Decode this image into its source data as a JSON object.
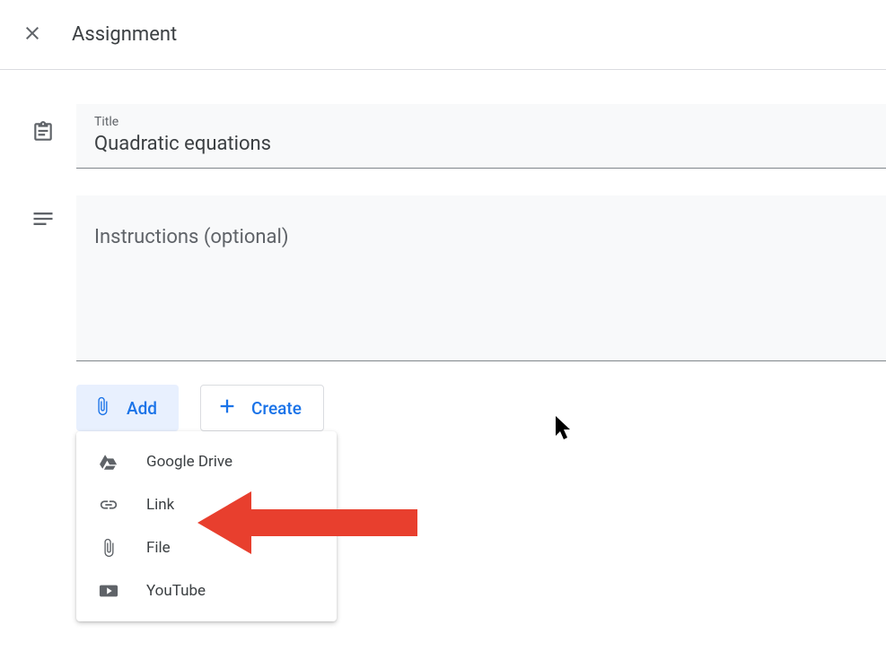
{
  "header": {
    "title": "Assignment"
  },
  "form": {
    "title_label": "Title",
    "title_value": "Quadratic equations",
    "instructions_placeholder": "Instructions (optional)"
  },
  "buttons": {
    "add_label": "Add",
    "create_label": "Create"
  },
  "add_menu": {
    "items": [
      {
        "label": "Google Drive"
      },
      {
        "label": "Link"
      },
      {
        "label": "File"
      },
      {
        "label": "YouTube"
      }
    ]
  }
}
